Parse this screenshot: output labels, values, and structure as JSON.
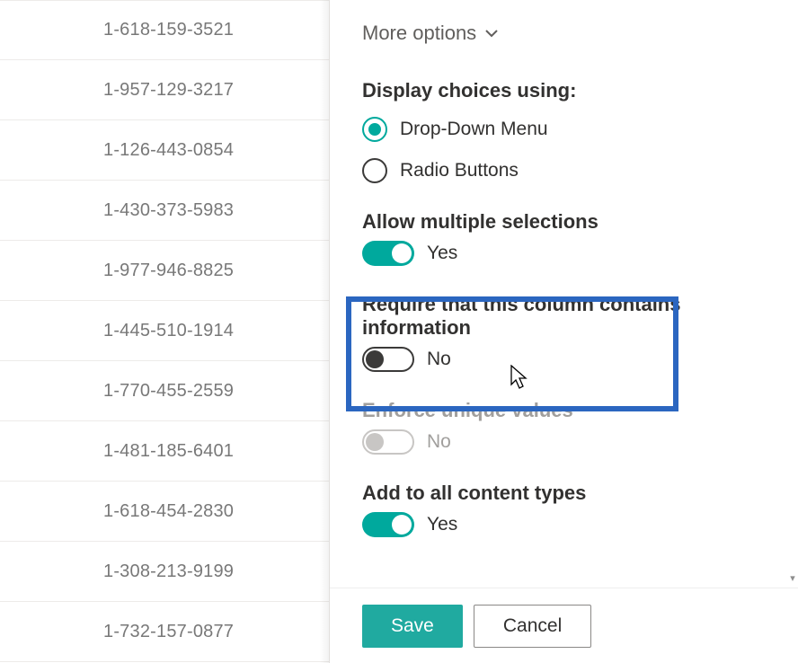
{
  "list": {
    "rows": [
      "1-618-159-3521",
      "1-957-129-3217",
      "1-126-443-0854",
      "1-430-373-5983",
      "1-977-946-8825",
      "1-445-510-1914",
      "1-770-455-2559",
      "1-481-185-6401",
      "1-618-454-2830",
      "1-308-213-9199",
      "1-732-157-0877"
    ]
  },
  "panel": {
    "more_options_label": "More options",
    "display_choices_label": "Display choices using:",
    "radios": {
      "dropdown_label": "Drop-Down Menu",
      "radiobuttons_label": "Radio Buttons",
      "selected": "dropdown"
    },
    "allow_multiple": {
      "label": "Allow multiple selections",
      "on": true,
      "value_text": "Yes"
    },
    "require_info": {
      "label": "Require that this column contains information",
      "on": false,
      "value_text": "No"
    },
    "enforce_unique": {
      "label": "Enforce unique values",
      "on": false,
      "disabled": true,
      "value_text": "No"
    },
    "add_all_types": {
      "label": "Add to all content types",
      "on": true,
      "value_text": "Yes"
    },
    "footer": {
      "save_label": "Save",
      "cancel_label": "Cancel"
    }
  }
}
